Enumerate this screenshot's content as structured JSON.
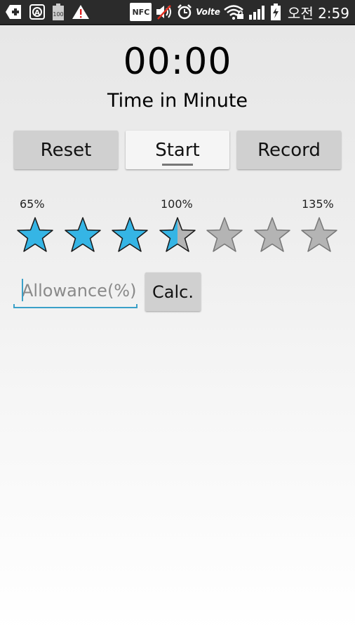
{
  "status_bar": {
    "left_icons": [
      "add-icon",
      "auto-rotate-icon",
      "battery-100-icon",
      "warning-icon"
    ],
    "nfc_label": "NFC",
    "volte_label": "Volte",
    "clock": "오전 2:59"
  },
  "timer": {
    "display": "00:00",
    "unit_label": "Time in Minute"
  },
  "buttons": {
    "reset": "Reset",
    "start": "Start",
    "record": "Record"
  },
  "rating": {
    "labels": {
      "min": "65%",
      "mid": "100%",
      "max": "135%"
    },
    "total_stars": 7,
    "filled_value": 3.5,
    "fill_color": "#35b5e5",
    "empty_color": "#b4b4b4"
  },
  "allowance": {
    "placeholder": "Allowance(%)",
    "value": "",
    "calc_label": "Calc."
  }
}
